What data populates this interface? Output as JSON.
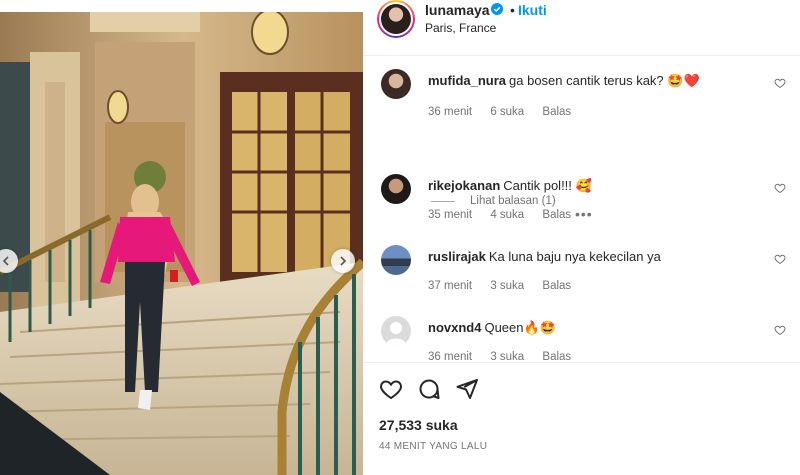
{
  "post": {
    "username": "lunamaya",
    "dot": "•",
    "follow_label": "Ikuti",
    "location": "Paris, France"
  },
  "comments": [
    {
      "user": "mufida_nura",
      "text": "ga bosen cantik terus kak? 🤩❤️",
      "age": "36 menit",
      "likes": "6 suka",
      "reply": "Balas"
    },
    {
      "user": "rikejokanan",
      "text": "Cantik pol!!! 🥰",
      "age": "35 menit",
      "likes": "4 suka",
      "reply": "Balas",
      "more": "•••"
    },
    {
      "user": "ruslirajak",
      "text": "Ka luna baju nya kekecilan ya",
      "age": "37 menit",
      "likes": "3 suka",
      "reply": "Balas"
    },
    {
      "user": "novxnd4",
      "text": "Queen🔥🤩",
      "age": "36 menit",
      "likes": "3 suka",
      "reply": "Balas"
    }
  ],
  "view_replies": "Lihat balasan (1)",
  "footer": {
    "likes": "27,533 suka",
    "time": "44 MENIT YANG LALU"
  },
  "icons": {
    "verified": "verified-badge-icon",
    "like": "heart-icon",
    "comment": "comment-icon",
    "share": "send-icon",
    "prev": "chevron-left-icon",
    "next": "chevron-right-icon"
  },
  "colors": {
    "accent": "#0095f6",
    "text": "#262626",
    "secondary": "#737373"
  }
}
